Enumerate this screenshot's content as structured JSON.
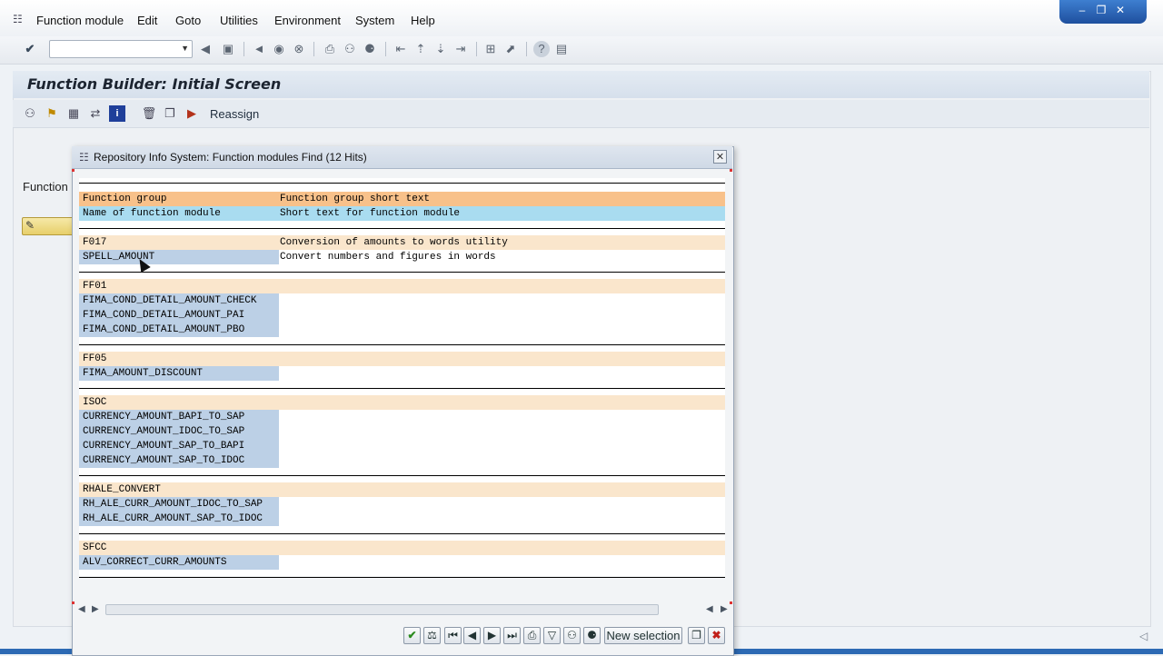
{
  "menu": {
    "items": [
      "Function module",
      "Edit",
      "Goto",
      "Utilities",
      "Environment",
      "System",
      "Help"
    ]
  },
  "window_controls": {
    "minimize": "–",
    "restore": "❐",
    "close": "✕"
  },
  "toolbar": {
    "command_field_value": "",
    "icons": [
      "enter-check-icon",
      "back-arrow-icon",
      "save-icon",
      "back-icon",
      "exit-icon",
      "cancel-icon",
      "print-icon",
      "find-icon",
      "find-next-icon",
      "first-page-icon",
      "prev-page-icon",
      "next-page-icon",
      "last-page-icon",
      "new-session-icon",
      "shortcut-icon",
      "help-icon",
      "customize-layout-icon"
    ]
  },
  "main": {
    "page_title": "Function Builder: Initial Screen",
    "app_toolbar": {
      "reassign_label": "Reassign"
    },
    "function_module_label": "Function m"
  },
  "dialog": {
    "title": "Repository Info System: Function modules Find (12 Hits)",
    "close_symbol": "✕",
    "header": {
      "col1": "Function group",
      "col2": "Function group short text",
      "sub_col1": "Name of function module",
      "sub_col2": "Short text for function module"
    },
    "groups": [
      {
        "name": "F017",
        "short_text": "Conversion of amounts to words utility",
        "modules": [
          {
            "name": "SPELL_AMOUNT",
            "text": "Convert numbers and figures in words"
          }
        ]
      },
      {
        "name": "FF01",
        "short_text": "",
        "modules": [
          {
            "name": "FIMA_COND_DETAIL_AMOUNT_CHECK",
            "text": ""
          },
          {
            "name": "FIMA_COND_DETAIL_AMOUNT_PAI",
            "text": ""
          },
          {
            "name": "FIMA_COND_DETAIL_AMOUNT_PBO",
            "text": ""
          }
        ]
      },
      {
        "name": "FF05",
        "short_text": "",
        "modules": [
          {
            "name": "FIMA_AMOUNT_DISCOUNT",
            "text": ""
          }
        ]
      },
      {
        "name": "ISOC",
        "short_text": "",
        "modules": [
          {
            "name": "CURRENCY_AMOUNT_BAPI_TO_SAP",
            "text": ""
          },
          {
            "name": "CURRENCY_AMOUNT_IDOC_TO_SAP",
            "text": ""
          },
          {
            "name": "CURRENCY_AMOUNT_SAP_TO_BAPI",
            "text": ""
          },
          {
            "name": "CURRENCY_AMOUNT_SAP_TO_IDOC",
            "text": ""
          }
        ]
      },
      {
        "name": "RHALE_CONVERT",
        "short_text": "",
        "modules": [
          {
            "name": "RH_ALE_CURR_AMOUNT_IDOC_TO_SAP",
            "text": ""
          },
          {
            "name": "RH_ALE_CURR_AMOUNT_SAP_TO_IDOC",
            "text": ""
          }
        ]
      },
      {
        "name": "SFCC",
        "short_text": "",
        "modules": [
          {
            "name": "ALV_CORRECT_CURR_AMOUNTS",
            "text": ""
          }
        ]
      }
    ],
    "buttons": {
      "new_selection": "New selection",
      "continue": "✔",
      "cancel": "✖"
    }
  }
}
